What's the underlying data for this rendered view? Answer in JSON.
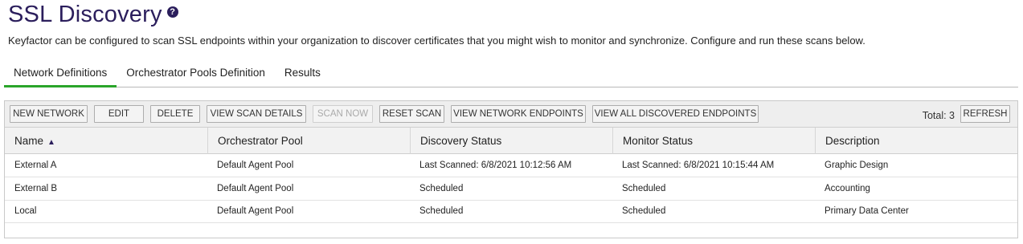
{
  "page": {
    "title": "SSL Discovery",
    "help_icon": "question-circle-icon",
    "intro": "Keyfactor can be configured to scan SSL endpoints within your organization to discover certificates that you might wish to monitor and synchronize. Configure and run these scans below."
  },
  "tabs": [
    {
      "label": "Network Definitions",
      "active": true
    },
    {
      "label": "Orchestrator Pools Definition",
      "active": false
    },
    {
      "label": "Results",
      "active": false
    }
  ],
  "toolbar": {
    "new_network": "NEW NETWORK",
    "edit": "EDIT",
    "delete": "DELETE",
    "view_scan_details": "VIEW SCAN DETAILS",
    "scan_now": "SCAN NOW",
    "reset_scan": "RESET SCAN",
    "view_network_endpoints": "VIEW NETWORK ENDPOINTS",
    "view_all_discovered_endpoints": "VIEW ALL DISCOVERED ENDPOINTS",
    "total": "Total: 3",
    "refresh": "REFRESH"
  },
  "table": {
    "columns": [
      "Name",
      "Orchestrator Pool",
      "Discovery Status",
      "Monitor Status",
      "Description"
    ],
    "sort_icon": "sort-ascending-icon",
    "rows": [
      [
        "External A",
        "Default Agent Pool",
        "Last Scanned: 6/8/2021 10:12:56 AM",
        "Last Scanned: 6/8/2021 10:15:44 AM",
        "Graphic Design"
      ],
      [
        "External B",
        "Default Agent Pool",
        "Scheduled",
        "Scheduled",
        "Accounting"
      ],
      [
        "Local",
        "Default Agent Pool",
        "Scheduled",
        "Scheduled",
        "Primary Data Center"
      ]
    ]
  },
  "colors": {
    "title": "#2b1e5c",
    "active_tab_underline": "#2aa52a"
  }
}
